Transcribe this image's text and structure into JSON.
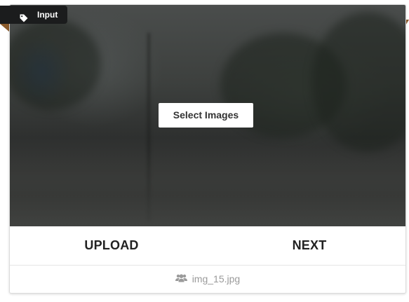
{
  "ribbon": {
    "label": "Input",
    "icon": "tag-icon",
    "background_color": "#1b1c1d",
    "tail_color": "#8a5a2b"
  },
  "image_panel": {
    "select_button_label": "Select Images"
  },
  "actions": {
    "upload_label": "UPLOAD",
    "next_label": "NEXT"
  },
  "footer": {
    "icon": "users-icon",
    "filename": "img_15.jpg"
  }
}
